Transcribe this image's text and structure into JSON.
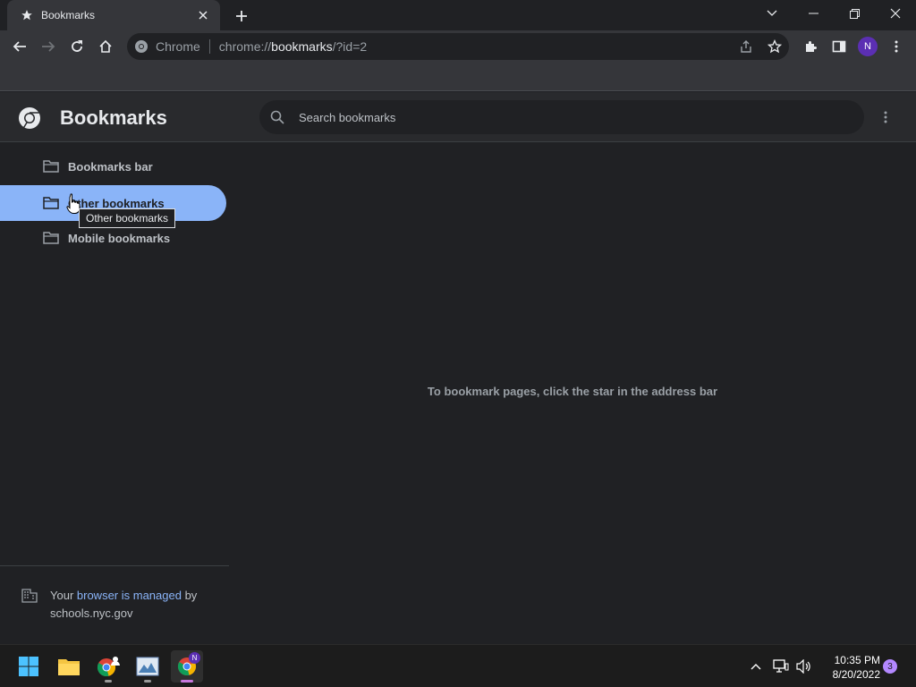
{
  "tab": {
    "title": "Bookmarks"
  },
  "toolbar": {
    "site_label": "Chrome",
    "url_prefix": "chrome://",
    "url_host": "bookmarks",
    "url_rest": "/?id=2",
    "profile_initial": "N"
  },
  "header": {
    "title": "Bookmarks",
    "search_placeholder": "Search bookmarks"
  },
  "sidebar": {
    "folders": [
      {
        "label": "Bookmarks bar",
        "selected": false
      },
      {
        "label": "Other bookmarks",
        "selected": true
      },
      {
        "label": "Mobile bookmarks",
        "selected": false
      }
    ],
    "tooltip": "Other bookmarks"
  },
  "managed": {
    "prefix": "Your ",
    "link": "browser is managed",
    "suffix": " by",
    "domain": "schools.nyc.gov"
  },
  "main": {
    "empty_message": "To bookmark pages, click the star in the address bar"
  },
  "taskbar": {
    "time": "10:35 PM",
    "date": "8/20/2022",
    "notification_count": "3",
    "chrome_badge": "N"
  },
  "colors": {
    "accent": "#8ab4f8",
    "background": "#202124",
    "header": "#292a2d",
    "toolbar": "#35363a"
  }
}
